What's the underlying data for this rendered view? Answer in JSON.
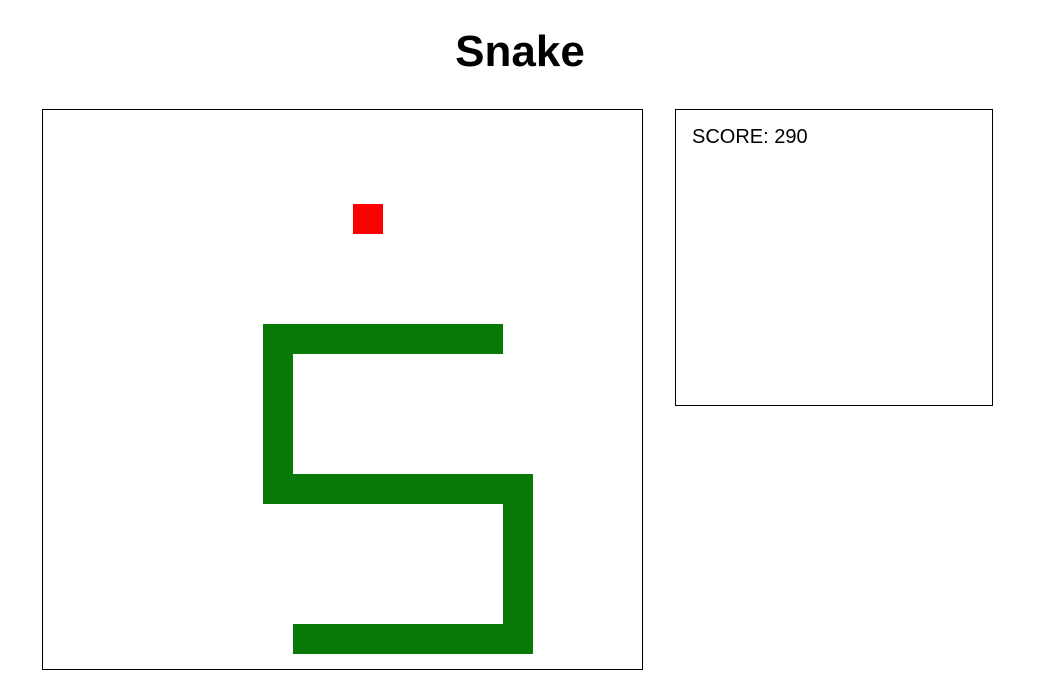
{
  "game": {
    "title": "Snake",
    "score_label": "SCORE:",
    "score_value": "290"
  },
  "board": {
    "columns": 20,
    "rows": 19,
    "snake_color": "#087a08",
    "food_color": "#ff0000",
    "food": [
      10,
      3
    ],
    "snake": [
      [
        14,
        7
      ],
      [
        13,
        7
      ],
      [
        12,
        7
      ],
      [
        11,
        7
      ],
      [
        10,
        7
      ],
      [
        9,
        7
      ],
      [
        8,
        7
      ],
      [
        7,
        7
      ],
      [
        7,
        8
      ],
      [
        7,
        9
      ],
      [
        7,
        10
      ],
      [
        7,
        11
      ],
      [
        7,
        12
      ],
      [
        8,
        12
      ],
      [
        9,
        12
      ],
      [
        10,
        12
      ],
      [
        11,
        12
      ],
      [
        12,
        12
      ],
      [
        13,
        12
      ],
      [
        14,
        12
      ],
      [
        15,
        12
      ],
      [
        15,
        13
      ],
      [
        15,
        14
      ],
      [
        15,
        15
      ],
      [
        15,
        16
      ],
      [
        15,
        17
      ],
      [
        14,
        17
      ],
      [
        13,
        17
      ],
      [
        12,
        17
      ],
      [
        11,
        17
      ],
      [
        10,
        17
      ],
      [
        9,
        17
      ],
      [
        8,
        17
      ]
    ]
  }
}
